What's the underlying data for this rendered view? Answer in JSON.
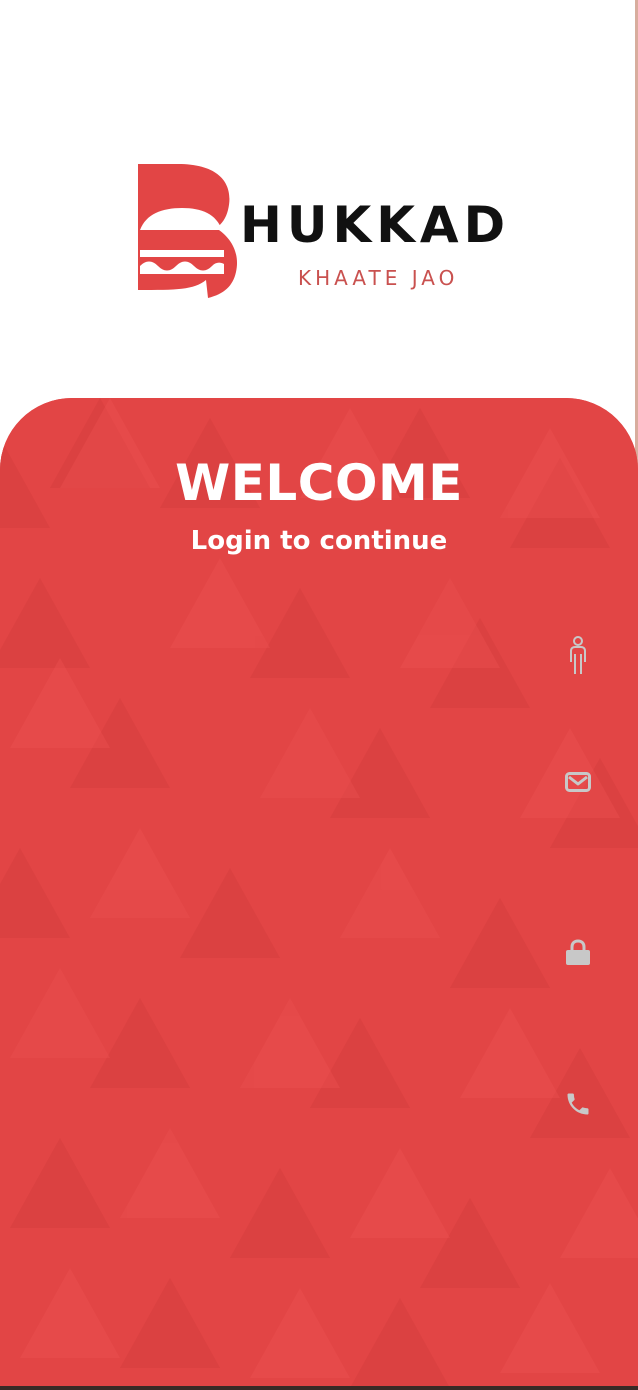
{
  "brand": {
    "name": "HUKKAD",
    "tagline": "KHAATE JAO",
    "logo_icon": "burger-b-logo",
    "accent_color": "#e24545",
    "wordmark_color": "#111111",
    "tagline_color": "#c9514f"
  },
  "welcome": {
    "title": "WELCOME",
    "subtitle": "Login to continue"
  },
  "form": {
    "fields": [
      {
        "name": "name",
        "icon": "person-icon",
        "value": "",
        "placeholder": ""
      },
      {
        "name": "email",
        "icon": "mail-icon",
        "value": "",
        "placeholder": ""
      },
      {
        "name": "password",
        "icon": "lock-icon",
        "value": "",
        "placeholder": ""
      },
      {
        "name": "phone",
        "icon": "phone-icon",
        "value": "",
        "placeholder": ""
      }
    ],
    "icon_color": "#c8c8c8"
  }
}
